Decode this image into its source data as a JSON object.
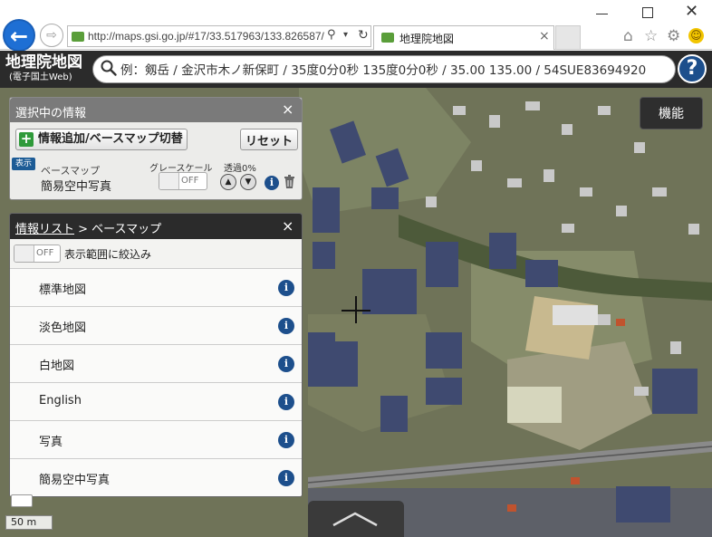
{
  "browser": {
    "url": "http://maps.gsi.go.jp/#17/33.517963/133.826587/",
    "tab_title": "地理院地図",
    "back_icon": "←",
    "fwd_icon": "⇨",
    "search_icon": "⚲",
    "dropdown_icon": "▾",
    "refresh_icon": "↻",
    "tab_close": "×",
    "min_label": "",
    "close_icon": "✕",
    "home_icon": "⌂",
    "star_icon": "☆",
    "gear_icon": "⚙",
    "smiley_icon": "☺"
  },
  "app": {
    "logo_main": "地理院地図",
    "logo_sub": "(電子国土Web)",
    "search_placeholder": "例：剱岳 / 金沢市木ノ新保町 / 35度0分0秒 135度0分0秒 / 35.00 135.00 / 54SUE83694920",
    "search_icon": "🔍",
    "help_label": "?",
    "kinou_label": "機能"
  },
  "panel_selected": {
    "title": "選択中の情報",
    "close": "×",
    "add_button": "情報追加/ベースマップ切替",
    "add_icon": "+",
    "reset_button": "リセット",
    "show_badge": "表示",
    "basemap_label": "ベースマップ",
    "basemap_name": "簡易空中写真",
    "grayscale_label": "グレースケール",
    "grayscale_state": "OFF",
    "opacity_label": "透過0%",
    "up": "▲",
    "down": "▼",
    "info": "i",
    "trash_icon": "🗑"
  },
  "panel_list": {
    "crumb_link": "情報リスト",
    "crumb_rest": " > ベースマップ",
    "close": "×",
    "filter_state": "OFF",
    "filter_label": "表示範囲に絞込み",
    "info": "i",
    "items": [
      {
        "label": "標準地図"
      },
      {
        "label": "淡色地図"
      },
      {
        "label": "白地図"
      },
      {
        "label": "English"
      },
      {
        "label": "写真"
      },
      {
        "label": "簡易空中写真"
      }
    ]
  },
  "map": {
    "scale_label": "50 m",
    "zoom_plus": "+"
  }
}
